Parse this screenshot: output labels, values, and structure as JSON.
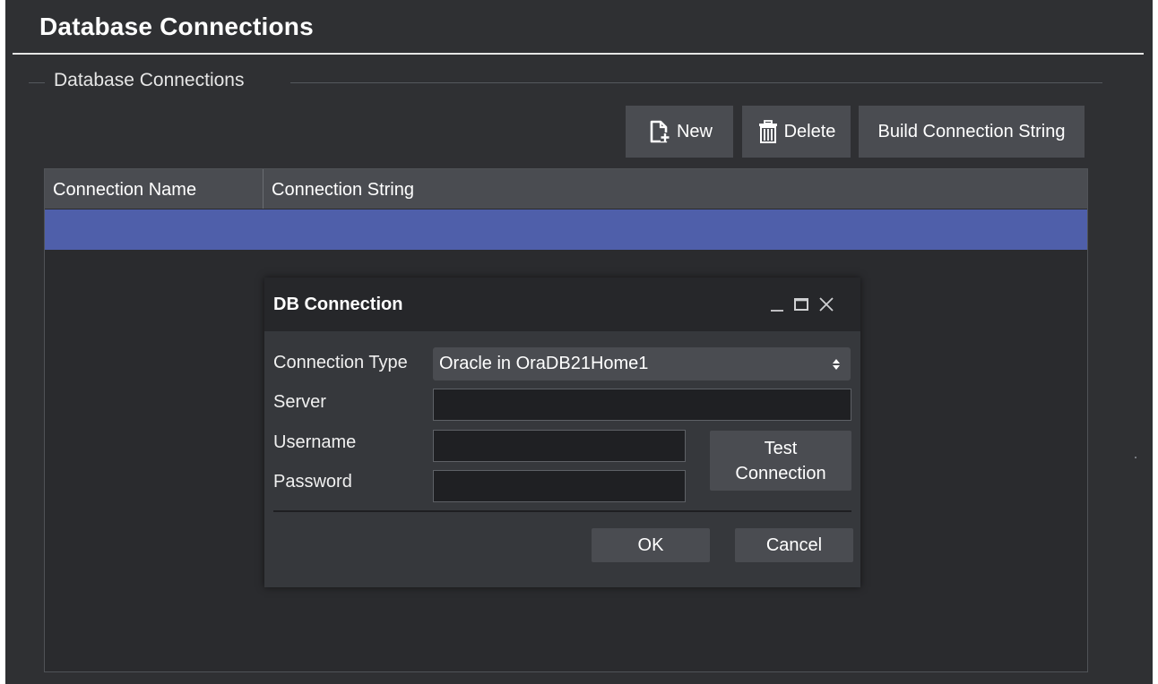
{
  "page": {
    "title": "Database Connections"
  },
  "group": {
    "title": "Database Connections"
  },
  "toolbar": {
    "new_label": "New",
    "delete_label": "Delete",
    "build_label": "Build Connection String",
    "new_icon": "new-document-icon",
    "delete_icon": "trash-icon"
  },
  "grid": {
    "columns": [
      "Connection Name",
      "Connection String"
    ],
    "rows": [
      {
        "connection_name": "",
        "connection_string": "",
        "selected": true
      }
    ],
    "selection_color": "#4f5faa"
  },
  "dialog": {
    "title": "DB Connection",
    "controls": {
      "minimize_icon": "minimize-icon",
      "maximize_icon": "maximize-icon",
      "close_icon": "close-icon"
    },
    "connection_type_label": "Connection Type",
    "connection_type_value": "Oracle in OraDB21Home1",
    "server_label": "Server",
    "server_value": "",
    "username_label": "Username",
    "username_value": "",
    "password_label": "Password",
    "password_value": "",
    "test_button_line1": "Test",
    "test_button_line2": "Connection",
    "ok_label": "OK",
    "cancel_label": "Cancel"
  },
  "colors": {
    "background": "#2f3033",
    "panel": "#4a4c51",
    "selection": "#4f5faa",
    "text": "#ffffff"
  }
}
